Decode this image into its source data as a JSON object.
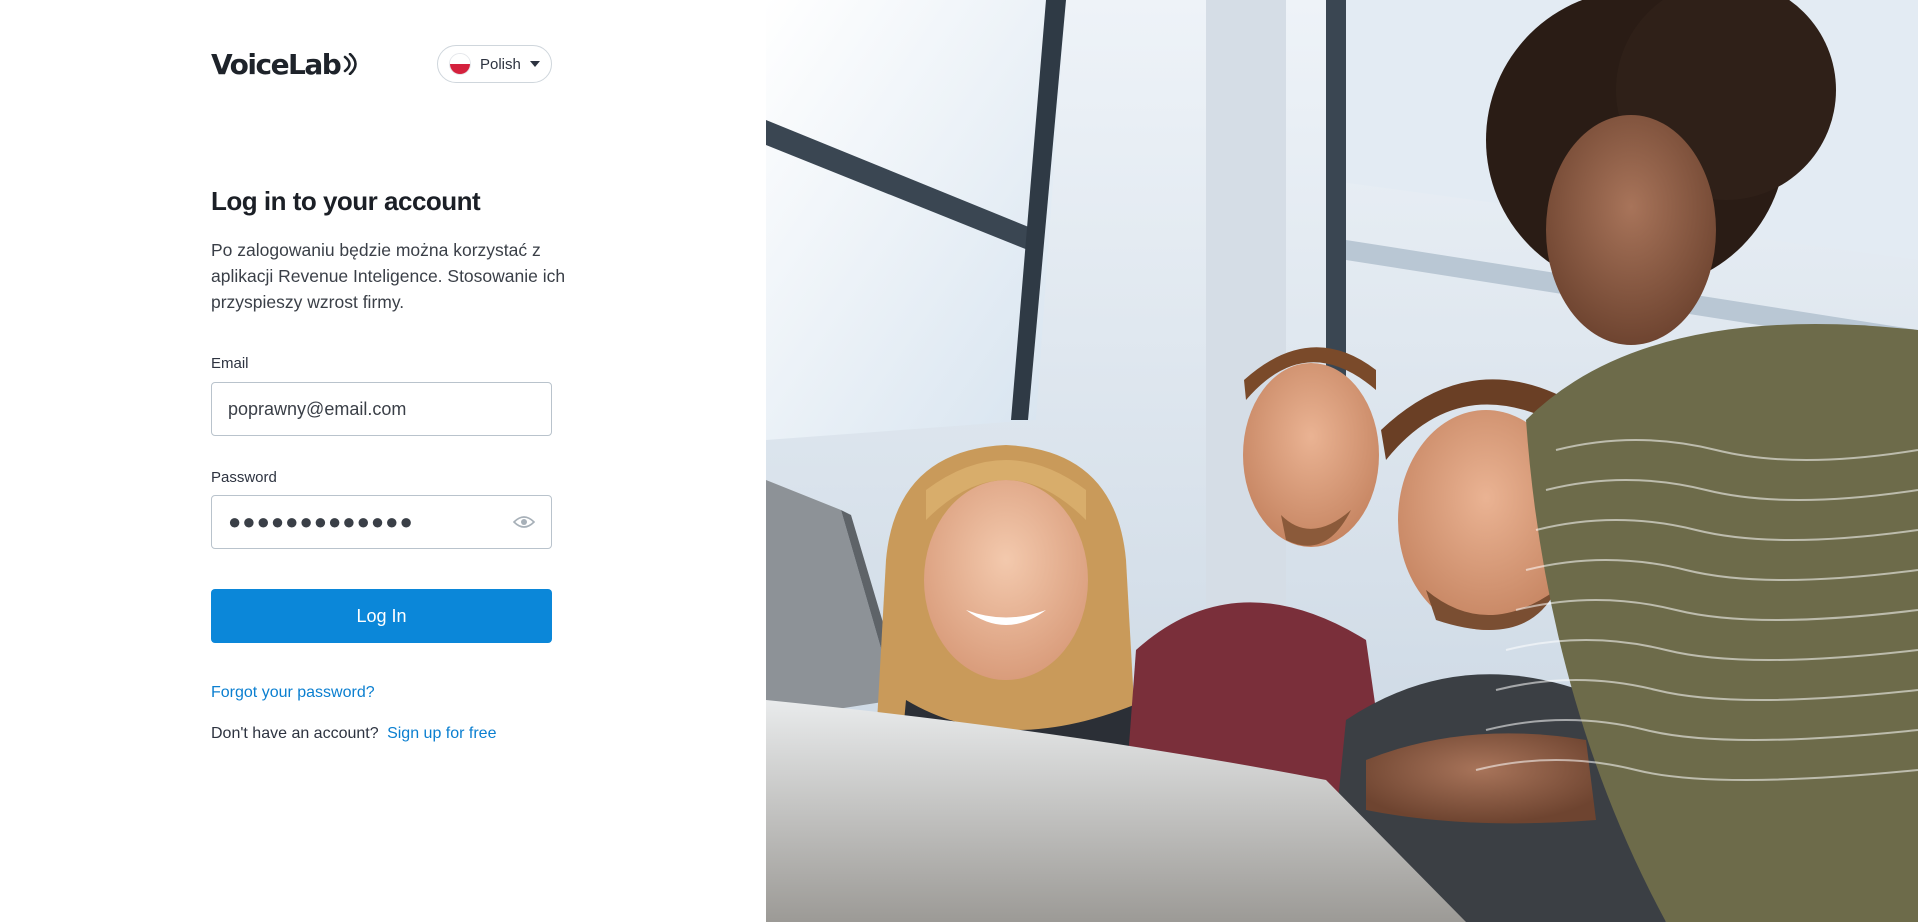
{
  "brand": {
    "name": "VoiceLab"
  },
  "language": {
    "selected": "Polish",
    "flag": "pl-flag-icon"
  },
  "login": {
    "title": "Log in to your account",
    "description": "Po zalogowaniu będzie można korzystać z aplikacji Revenue Inteligence. Stosowanie ich przyspieszy wzrost firmy.",
    "email_label": "Email",
    "email_value": "poprawny@email.com",
    "password_label": "Password",
    "password_value": "●●●●●●●●●●●●●",
    "show_password_icon": "eye-icon",
    "submit_label": "Log In",
    "forgot_label": "Forgot your password?",
    "no_account_text": "Don't have an account?",
    "signup_label": "Sign up for free"
  },
  "colors": {
    "primary": "#0b87d9",
    "link": "#0b7fd0",
    "text_dark": "#1b1f26"
  }
}
